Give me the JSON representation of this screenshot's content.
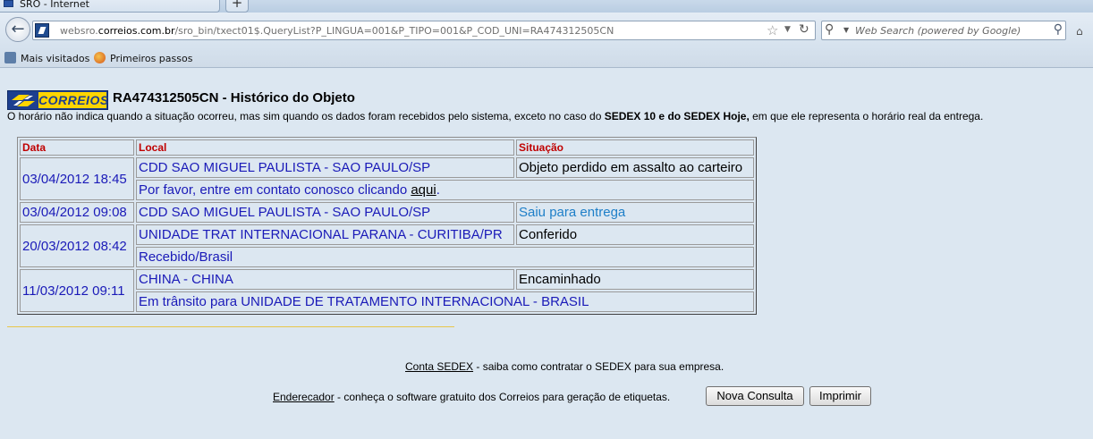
{
  "browser": {
    "tab_title": "SRO - Internet",
    "new_tab": "+",
    "url_host": "websro.correios.com.br",
    "url_path": "/sro_bin/txect01$.QueryList?P_LINGUA=001&P_TIPO=001&P_COD_UNI=RA474312505CN",
    "url_prefix": "websro.",
    "url_domain": "correios.com.br",
    "search_placeholder": "Web Search (powered by Google)",
    "bookmarks": [
      {
        "label": "Mais visitados",
        "icon": "bookmarks-folder-icon"
      },
      {
        "label": "Primeiros passos",
        "icon": "firefox-icon"
      }
    ]
  },
  "page": {
    "logo_text": "CORREIOS",
    "title": "RA474312505CN - Histórico do Objeto",
    "notice_pre": "O horário não indica quando a situação ocorreu, mas sim quando os dados foram recebidos pelo sistema, exceto no caso do ",
    "notice_bold": "SEDEX 10 e do SEDEX Hoje,",
    "notice_post": " em que ele representa o horário real da entrega.",
    "table": {
      "headers": {
        "date": "Data",
        "local": "Local",
        "status": "Situação"
      },
      "rows": [
        {
          "date": "03/04/2012 18:45",
          "local": "CDD SAO MIGUEL PAULISTA - SAO PAULO/SP",
          "status": "Objeto perdido em assalto ao carteiro",
          "detail_pre": "Por favor, entre em contato conosco clicando ",
          "detail_link": "aqui",
          "detail_post": "."
        },
        {
          "date": "03/04/2012 09:08",
          "local": "CDD SAO MIGUEL PAULISTA - SAO PAULO/SP",
          "status": "Saiu para entrega"
        },
        {
          "date": "20/03/2012 08:42",
          "local": "UNIDADE TRAT INTERNACIONAL PARANA - CURITIBA/PR",
          "status": "Conferido",
          "detail": "Recebido/Brasil"
        },
        {
          "date": "11/03/2012 09:11",
          "local": "CHINA - CHINA",
          "status": "Encaminhado",
          "detail": "Em trânsito para UNIDADE DE TRATAMENTO INTERNACIONAL - BRASIL"
        }
      ]
    },
    "footer": {
      "sedex_link": "Conta SEDEX",
      "sedex_text": " - saiba como contratar o SEDEX para sua empresa.",
      "enderecador_link": "Enderecador",
      "enderecador_text": " - conheça o software gratuito dos Correios para geração de etiquetas.",
      "new_query_button": "Nova Consulta",
      "print_button": "Imprimir"
    }
  },
  "colors": {
    "logo_blue": "#1d3f8f",
    "logo_yellow": "#ffd500",
    "header_red": "#c00000",
    "link_blue": "#1a1ab8",
    "status_blue": "#1e7fc8"
  }
}
